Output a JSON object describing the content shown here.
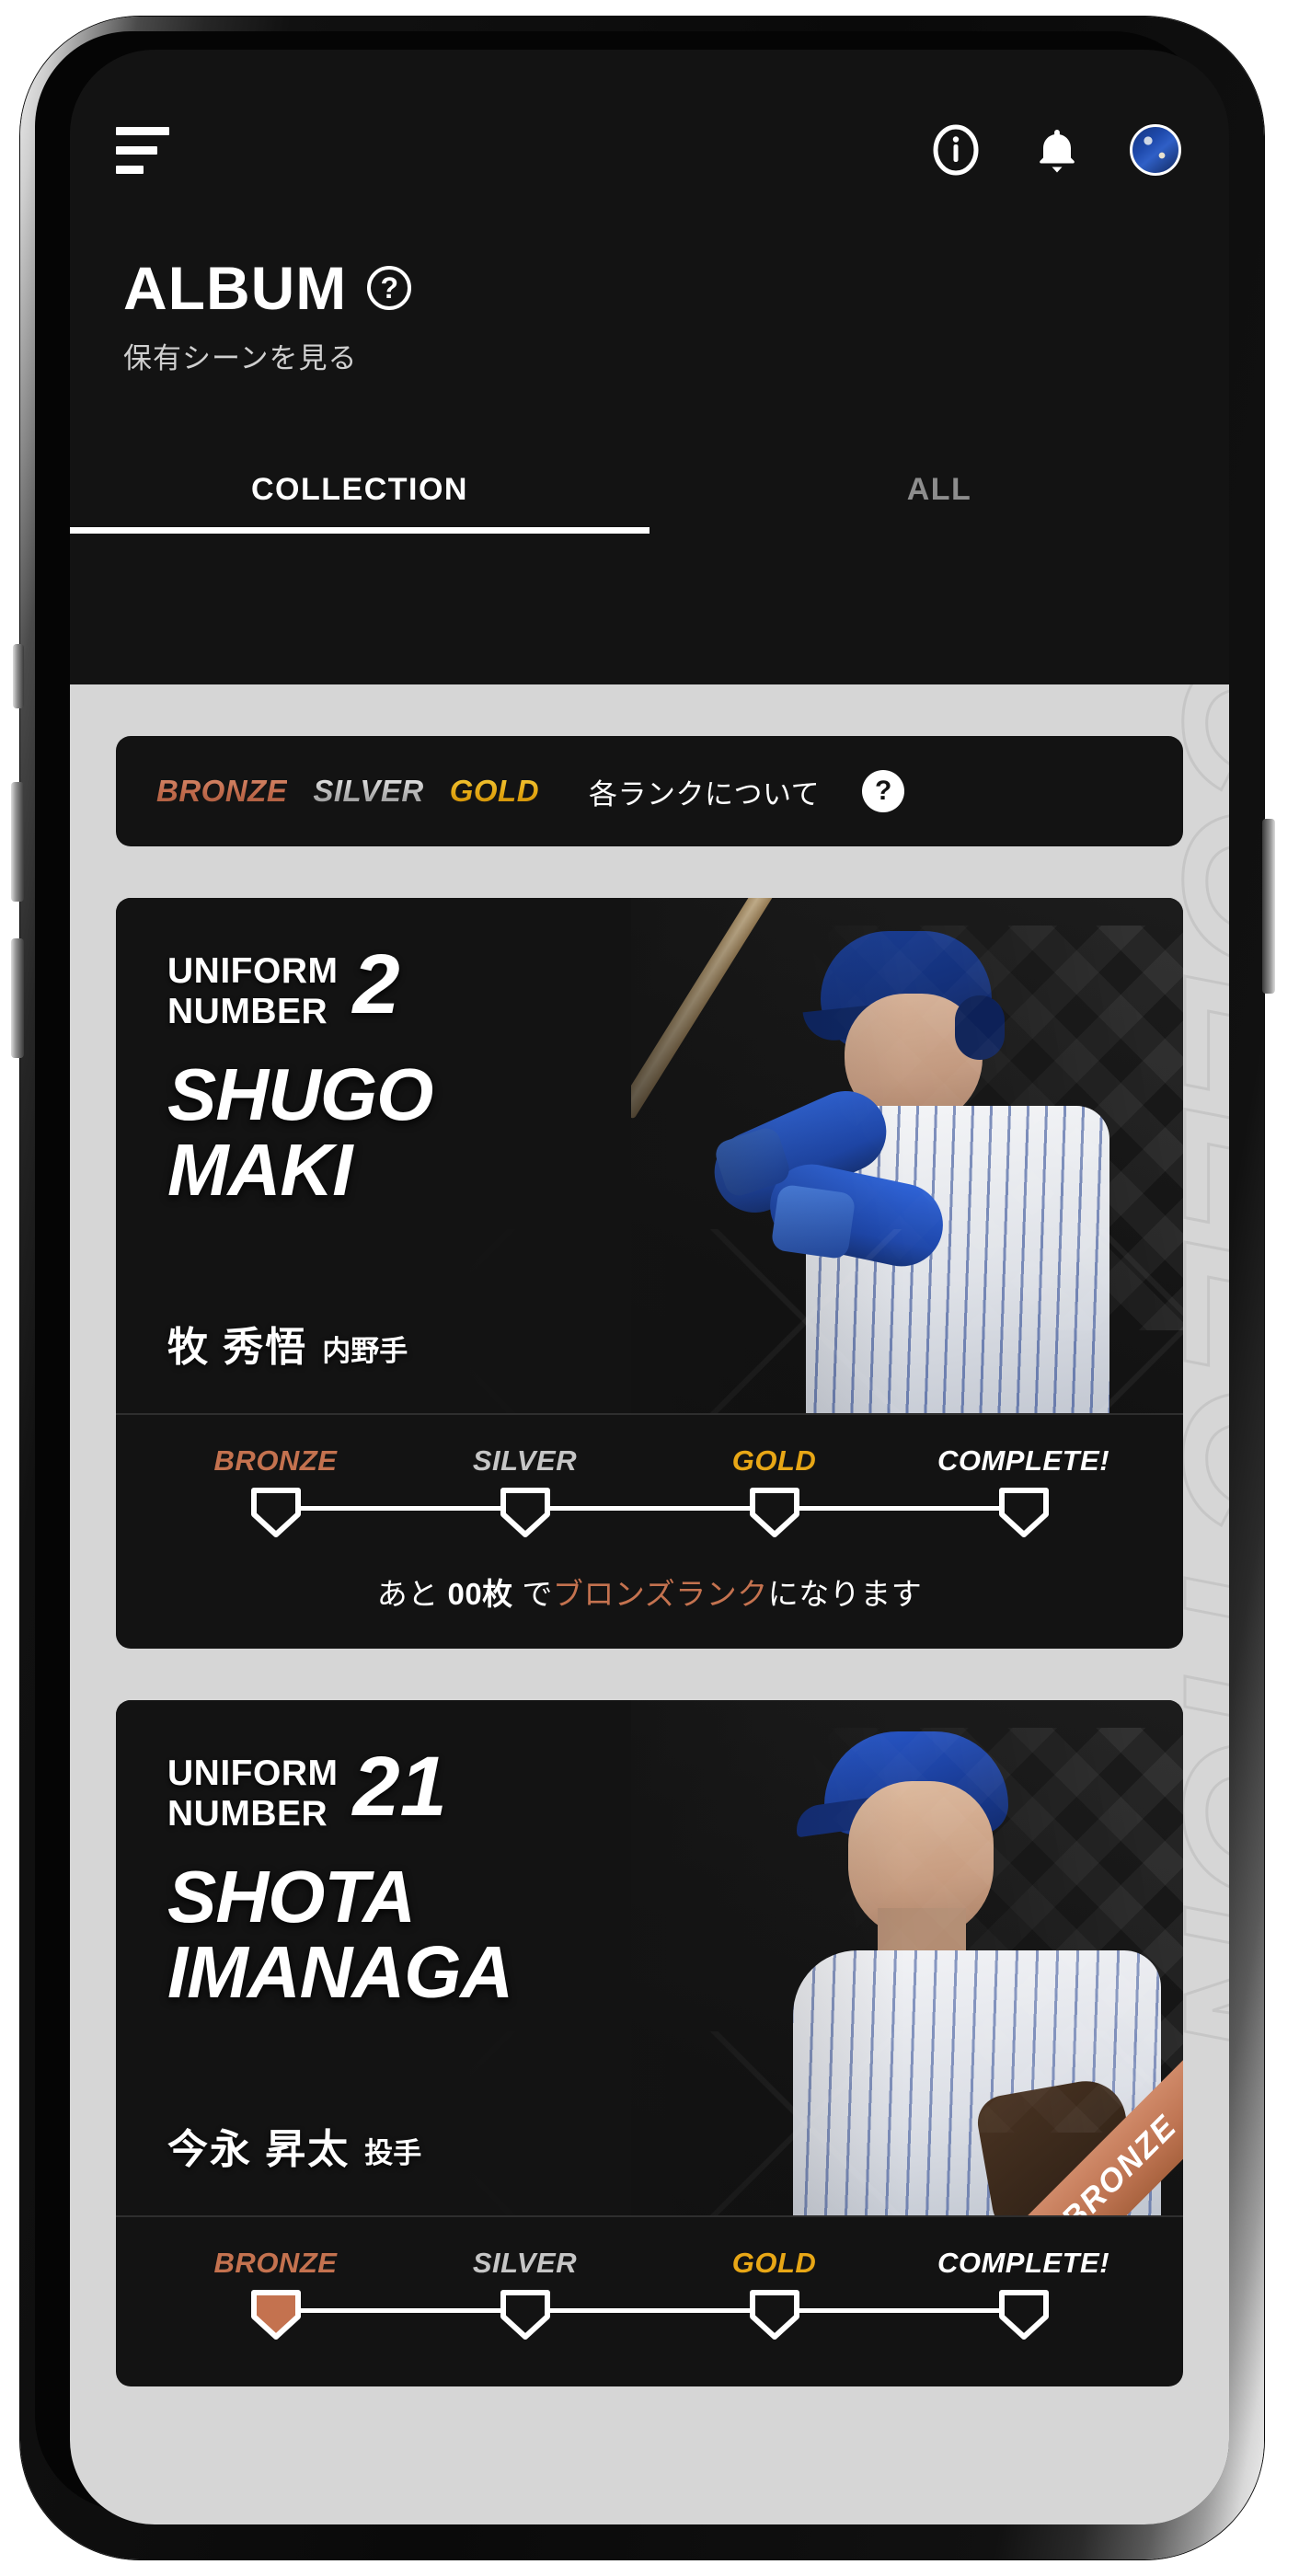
{
  "header": {
    "menu_icon": "hamburger-icon",
    "info_icon": "info-circle-icon",
    "bell_icon": "bell-icon",
    "avatar_icon": "user-avatar",
    "title": "ALBUM",
    "title_help": "?",
    "subtitle": "保有シーンを見る",
    "tabs": [
      {
        "label": "COLLECTION",
        "active": true
      },
      {
        "label": "ALL",
        "active": false
      }
    ]
  },
  "legend": {
    "ranks": [
      {
        "label": "BRONZE",
        "color": "#c06a4b"
      },
      {
        "label": "SILVER",
        "color": "#b9b9b9"
      },
      {
        "label": "GOLD",
        "color": "#e3a713"
      }
    ],
    "note": "各ランクについて",
    "help": "?"
  },
  "watermark": "COLLECTION",
  "cards": [
    {
      "uniform_label_line1": "UNIFORM",
      "uniform_label_line2": "NUMBER",
      "uniform_number": "2",
      "name_en_line1": "SHUGO",
      "name_en_line2": "MAKI",
      "name_jp": "牧 秀悟",
      "position_jp": "内野手",
      "badge": "",
      "ranks": [
        "BRONZE",
        "SILVER",
        "GOLD",
        "COMPLETE!"
      ],
      "progress": {
        "prefix": "あと ",
        "count": "00枚",
        "mid": " で",
        "accent": "ブロンズランク",
        "suffix": "になります"
      },
      "reached": 0
    },
    {
      "uniform_label_line1": "UNIFORM",
      "uniform_label_line2": "NUMBER",
      "uniform_number": "21",
      "name_en_line1": "SHOTA",
      "name_en_line2": "IMANAGA",
      "name_jp": "今永 昇太",
      "position_jp": "投手",
      "badge": "BRONZE",
      "ranks": [
        "BRONZE",
        "SILVER",
        "GOLD",
        "COMPLETE!"
      ],
      "progress": {
        "prefix": "",
        "count": "",
        "mid": "",
        "accent": "",
        "suffix": ""
      },
      "reached": 1
    }
  ],
  "colors": {
    "bronze": "#c4724f",
    "silver": "#c6c6c6",
    "gold": "#e8a716",
    "bg_dark": "#131313",
    "bg_body": "#d6d6d6"
  }
}
